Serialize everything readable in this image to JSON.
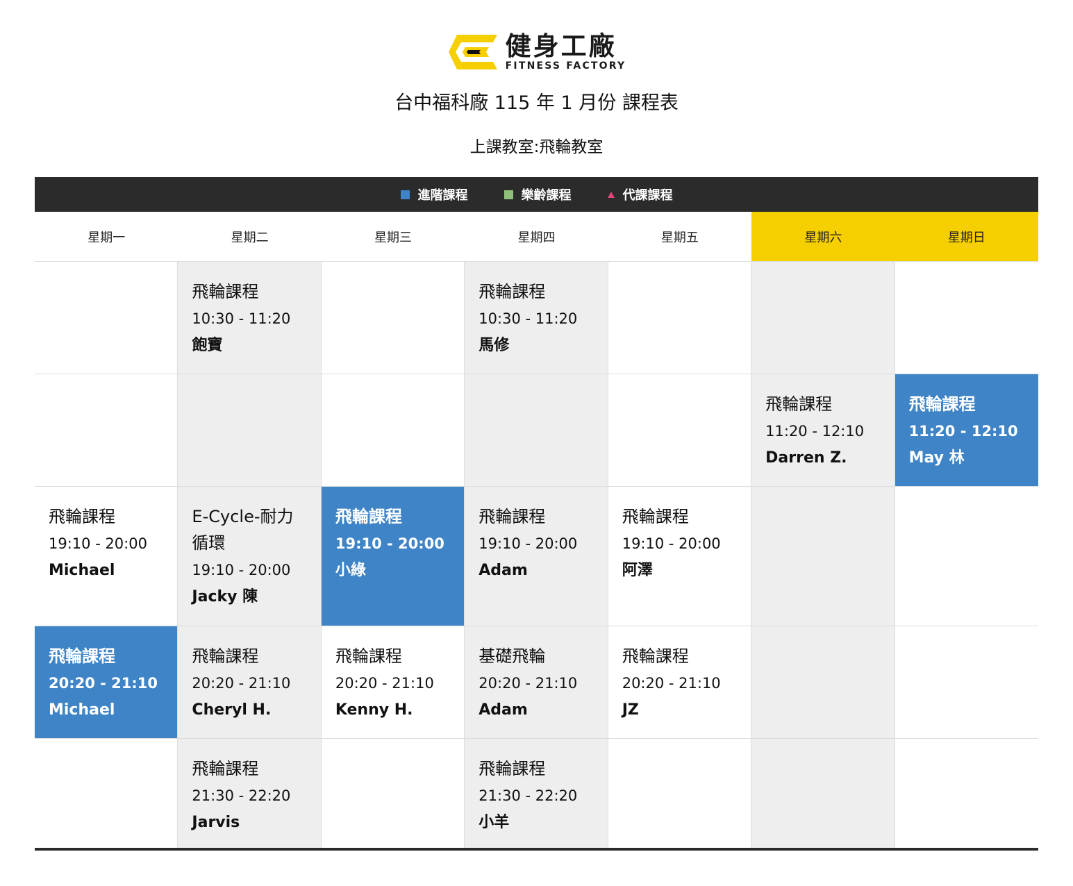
{
  "brand": {
    "name_zh": "健身工廠",
    "name_en": "FITNESS FACTORY"
  },
  "colors": {
    "advanced": "#3e84c6",
    "senior": "#8fc07a",
    "substitute": "#e0457b",
    "weekend": "#f6cf00",
    "bar": "#2b2b2b"
  },
  "header": {
    "title": "台中福科廠 115 年 1 月份 課程表",
    "room": "上課教室:飛輪教室"
  },
  "legend": [
    {
      "label": "進階課程",
      "icon": "blue-square-icon"
    },
    {
      "label": "樂齡課程",
      "icon": "green-square-icon"
    },
    {
      "label": "代課課程",
      "icon": "pink-triangle-icon"
    }
  ],
  "days": [
    "星期一",
    "星期二",
    "星期三",
    "星期四",
    "星期五",
    "星期六",
    "星期日"
  ],
  "rows": [
    [
      null,
      {
        "name": "飛輪課程",
        "time": "10:30 - 11:20",
        "coach": "飽寶"
      },
      null,
      {
        "name": "飛輪課程",
        "time": "10:30 - 11:20",
        "coach": "馬修"
      },
      null,
      null,
      null
    ],
    [
      null,
      null,
      null,
      null,
      null,
      {
        "name": "飛輪課程",
        "time": "11:20 - 12:10",
        "coach": "Darren Z."
      },
      {
        "name": "飛輪課程",
        "time": "11:20 - 12:10",
        "coach": "May 林",
        "advanced": true
      }
    ],
    [
      {
        "name": "飛輪課程",
        "time": "19:10 - 20:00",
        "coach": "Michael"
      },
      {
        "name": "E-Cycle-耐力循環",
        "time": "19:10 - 20:00",
        "coach": "Jacky 陳"
      },
      {
        "name": "飛輪課程",
        "time": "19:10 - 20:00",
        "coach": "小綠",
        "advanced": true
      },
      {
        "name": "飛輪課程",
        "time": "19:10 - 20:00",
        "coach": "Adam"
      },
      {
        "name": "飛輪課程",
        "time": "19:10 - 20:00",
        "coach": "阿澤"
      },
      null,
      null
    ],
    [
      {
        "name": "飛輪課程",
        "time": "20:20 - 21:10",
        "coach": "Michael",
        "advanced": true
      },
      {
        "name": "飛輪課程",
        "time": "20:20 - 21:10",
        "coach": "Cheryl H."
      },
      {
        "name": "飛輪課程",
        "time": "20:20 - 21:10",
        "coach": "Kenny H."
      },
      {
        "name": "基礎飛輪",
        "time": "20:20 - 21:10",
        "coach": "Adam"
      },
      {
        "name": "飛輪課程",
        "time": "20:20 - 21:10",
        "coach": "JZ"
      },
      null,
      null
    ],
    [
      null,
      {
        "name": "飛輪課程",
        "time": "21:30 - 22:20",
        "coach": "Jarvis"
      },
      null,
      {
        "name": "飛輪課程",
        "time": "21:30 - 22:20",
        "coach": "小羊"
      },
      null,
      null,
      null
    ]
  ]
}
